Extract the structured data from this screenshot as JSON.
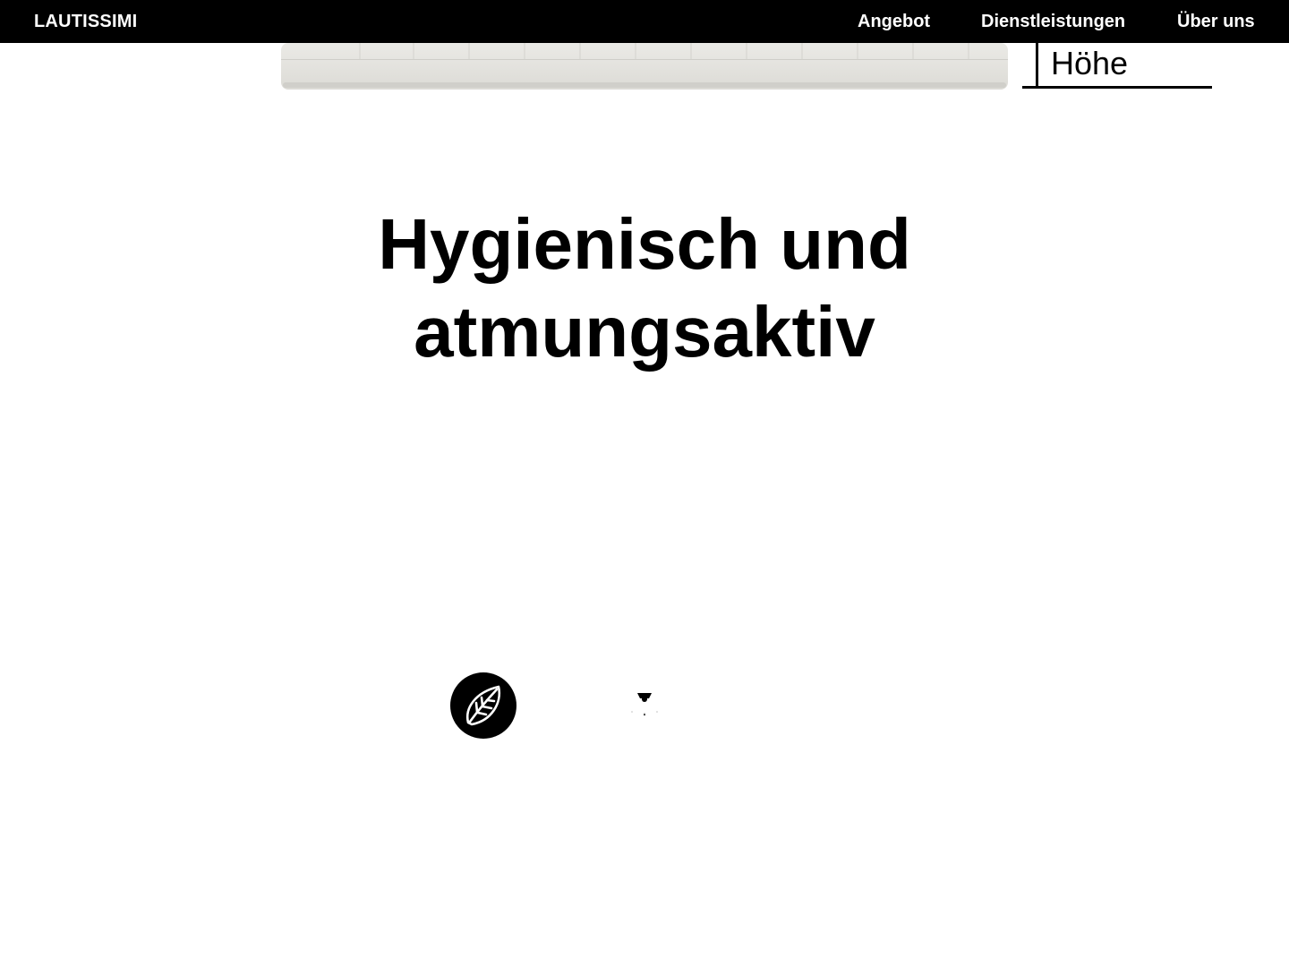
{
  "header": {
    "brand": "LAUTISSIMI",
    "nav": [
      {
        "label": "Angebot"
      },
      {
        "label": "Dienstleistungen"
      },
      {
        "label": "Über uns"
      }
    ]
  },
  "product": {
    "dimension_label": "Höhe"
  },
  "section": {
    "title_line1": "Hygienisch und",
    "title_line2": "atmungsaktiv"
  },
  "features": [
    {
      "icon": "leaf-icon"
    },
    {
      "icon": "person-icon"
    }
  ],
  "colors": {
    "background": "#ffffff",
    "topbar": "#000000",
    "text": "#000000",
    "mattress": "#e8e7e3"
  }
}
